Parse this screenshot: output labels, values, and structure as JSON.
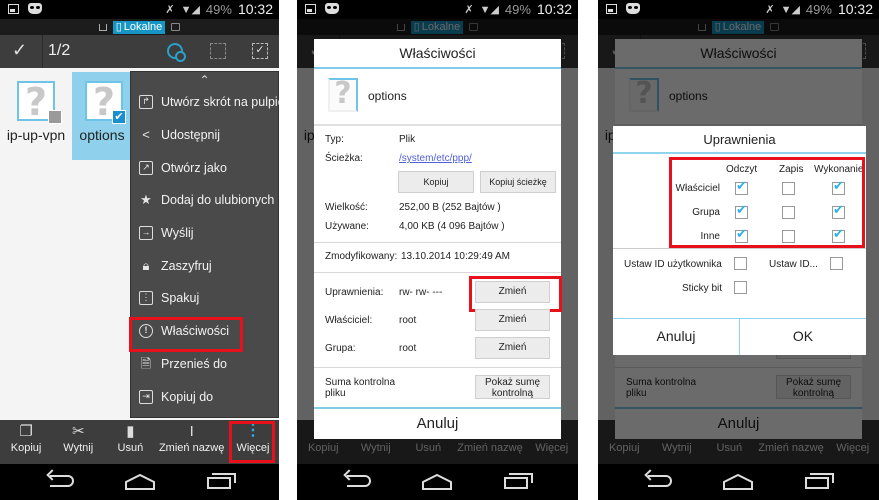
{
  "status_bar": {
    "battery": "49%",
    "time": "10:32"
  },
  "location_bar": {
    "storage_label": "Lokalne"
  },
  "panel1": {
    "action_bar": {
      "selection_count": "1/2"
    },
    "files": [
      {
        "name": "ip-up-vpn",
        "selected": false
      },
      {
        "name": "options",
        "selected": true
      }
    ],
    "menu": {
      "items": [
        {
          "label": "Utwórz skrót na pulpicie",
          "icon": "shortcut-icon"
        },
        {
          "label": "Udostępnij",
          "icon": "share-icon"
        },
        {
          "label": "Otwórz jako",
          "icon": "open-external-icon"
        },
        {
          "label": "Dodaj do ulubionych",
          "icon": "star-icon"
        },
        {
          "label": "Wyślij",
          "icon": "send-icon"
        },
        {
          "label": "Zaszyfruj",
          "icon": "lock-icon"
        },
        {
          "label": "Spakuj",
          "icon": "archive-icon"
        },
        {
          "label": "Właściwości",
          "icon": "info-icon",
          "highlighted": true
        },
        {
          "label": "Przenieś do",
          "icon": "move-icon"
        },
        {
          "label": "Kopiuj do",
          "icon": "copy-to-icon"
        }
      ]
    }
  },
  "bottom_bar": {
    "items": [
      {
        "label": "Kopiuj",
        "icon": "copy-icon"
      },
      {
        "label": "Wytnij",
        "icon": "cut-icon"
      },
      {
        "label": "Usuń",
        "icon": "trash-icon"
      },
      {
        "label": "Zmień nazwę",
        "icon": "rename-icon"
      },
      {
        "label": "Więcej",
        "icon": "more-icon"
      }
    ]
  },
  "properties_dialog": {
    "title": "Właściwości",
    "file_name": "options",
    "type_label": "Typ:",
    "type_value": "Plik",
    "path_label": "Ścieżka:",
    "path_value": "/system/etc/ppp/",
    "copy_button": "Kopiuj",
    "copy_path_button": "Kopiuj ścieżkę",
    "size_label": "Wielkość:",
    "size_value": "252,00 B (252 Bajtów )",
    "used_label": "Używane:",
    "used_value": "4,00 KB (4 096 Bajtów )",
    "modified_label": "Zmodyfikowany:",
    "modified_value": "13.10.2014 10:29:49 AM",
    "permissions_label": "Uprawnienia:",
    "permissions_value": "rw- rw- ---",
    "owner_label": "Właściciel:",
    "owner_value": "root",
    "group_label": "Grupa:",
    "group_value": "root",
    "change_button": "Zmień",
    "checksum_label": "Suma kontrolna pliku",
    "checksum_button": "Pokaż sumę kontrolną",
    "cancel_button": "Anuluj"
  },
  "permissions_dialog": {
    "title": "Uprawnienia",
    "columns": [
      "Odczyt",
      "Zapis",
      "Wykonanie"
    ],
    "rows": [
      {
        "label": "Właściciel",
        "read": true,
        "write": false,
        "execute": true
      },
      {
        "label": "Grupa",
        "read": true,
        "write": false,
        "execute": true
      },
      {
        "label": "Inne",
        "read": true,
        "write": false,
        "execute": true
      }
    ],
    "setuid_label": "Ustaw ID użytkownika",
    "setuid": false,
    "setgid_label": "Ustaw ID...",
    "setgid": false,
    "sticky_label": "Sticky bit",
    "sticky": false,
    "cancel_button": "Anuluj",
    "ok_button": "OK"
  },
  "colors": {
    "accent": "#2ab3e8",
    "highlight_box": "#e8101b",
    "selection": "#8fd0ec"
  }
}
